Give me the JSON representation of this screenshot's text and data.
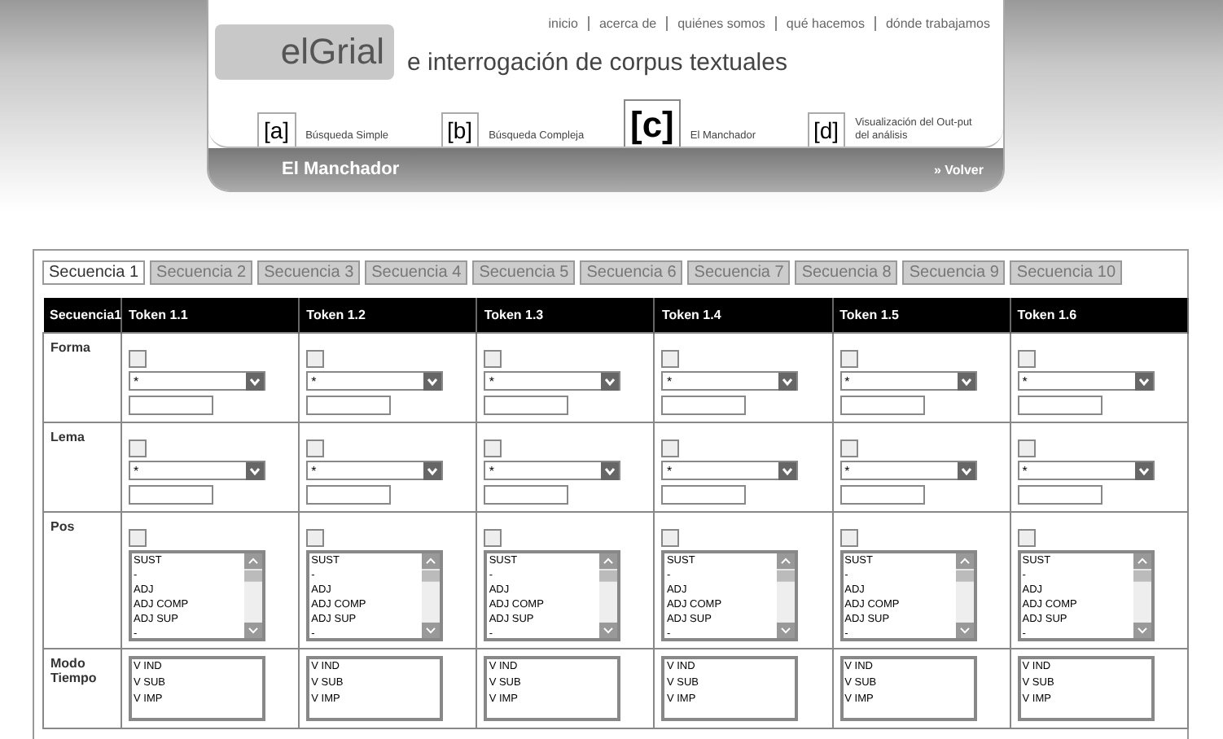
{
  "header": {
    "links": [
      "inicio",
      "acerca de",
      "quiénes somos",
      "qué hacemos",
      "dónde trabajamos"
    ],
    "logo": "elGrial",
    "tagline": "e interrogación de corpus textuales",
    "nav": [
      {
        "key": "[a]",
        "label": "Búsqueda Simple",
        "selected": false
      },
      {
        "key": "[b]",
        "label": "Búsqueda Compleja",
        "selected": false
      },
      {
        "key": "[c]",
        "label": "El Manchador",
        "selected": true
      },
      {
        "key": "[d]",
        "label": "Visualización del Out-put del análisis",
        "selected": false
      }
    ],
    "section_title": "El Manchador",
    "back_link": "» Volver"
  },
  "tabs": [
    {
      "label": "Secuencia 1",
      "selected": true
    },
    {
      "label": "Secuencia 2",
      "selected": false
    },
    {
      "label": "Secuencia 3",
      "selected": false
    },
    {
      "label": "Secuencia 4",
      "selected": false
    },
    {
      "label": "Secuencia 5",
      "selected": false
    },
    {
      "label": "Secuencia 6",
      "selected": false
    },
    {
      "label": "Secuencia 7",
      "selected": false
    },
    {
      "label": "Secuencia 8",
      "selected": false
    },
    {
      "label": "Secuencia 9",
      "selected": false
    },
    {
      "label": "Secuencia 10",
      "selected": false
    }
  ],
  "table": {
    "corner": "Secuencia1",
    "columns": [
      "Token 1.1",
      "Token 1.2",
      "Token 1.3",
      "Token 1.4",
      "Token 1.5",
      "Token 1.6"
    ],
    "rows": [
      {
        "label": "Forma",
        "kind": "select",
        "cells": [
          {
            "checked": false,
            "select": "*"
          },
          {
            "checked": false,
            "select": "*"
          },
          {
            "checked": false,
            "select": "*"
          },
          {
            "checked": false,
            "select": "*"
          },
          {
            "checked": false,
            "select": "*"
          },
          {
            "checked": false,
            "select": "*"
          }
        ]
      },
      {
        "label": "Lema",
        "kind": "select",
        "cells": [
          {
            "checked": false,
            "select": "*"
          },
          {
            "checked": false,
            "select": "*"
          },
          {
            "checked": false,
            "select": "*"
          },
          {
            "checked": false,
            "select": "*"
          },
          {
            "checked": false,
            "select": "*"
          },
          {
            "checked": false,
            "select": "*"
          }
        ]
      },
      {
        "label": "Pos",
        "kind": "list",
        "cells": [
          {
            "checked": false,
            "options": [
              "SUST",
              "-",
              "ADJ",
              "ADJ COMP",
              "ADJ SUP",
              "-"
            ]
          },
          {
            "checked": false,
            "options": [
              "SUST",
              "-",
              "ADJ",
              "ADJ COMP",
              "ADJ SUP",
              "-"
            ]
          },
          {
            "checked": false,
            "options": [
              "SUST",
              "-",
              "ADJ",
              "ADJ COMP",
              "ADJ SUP",
              "-"
            ]
          },
          {
            "checked": false,
            "options": [
              "SUST",
              "-",
              "ADJ",
              "ADJ COMP",
              "ADJ SUP",
              "-"
            ]
          },
          {
            "checked": false,
            "options": [
              "SUST",
              "-",
              "ADJ",
              "ADJ COMP",
              "ADJ SUP",
              "-"
            ]
          },
          {
            "checked": false,
            "options": [
              "SUST",
              "-",
              "ADJ",
              "ADJ COMP",
              "ADJ SUP",
              "-"
            ]
          }
        ]
      },
      {
        "label": "Modo Tiempo",
        "kind": "plainlist",
        "cells": [
          {
            "options": [
              "V IND",
              "V SUB",
              "V IMP"
            ]
          },
          {
            "options": [
              "V IND",
              "V SUB",
              "V IMP"
            ]
          },
          {
            "options": [
              "V IND",
              "V SUB",
              "V IMP"
            ]
          },
          {
            "options": [
              "V IND",
              "V SUB",
              "V IMP"
            ]
          },
          {
            "options": [
              "V IND",
              "V SUB",
              "V IMP"
            ]
          },
          {
            "options": [
              "V IND",
              "V SUB",
              "V IMP"
            ]
          }
        ]
      }
    ]
  }
}
